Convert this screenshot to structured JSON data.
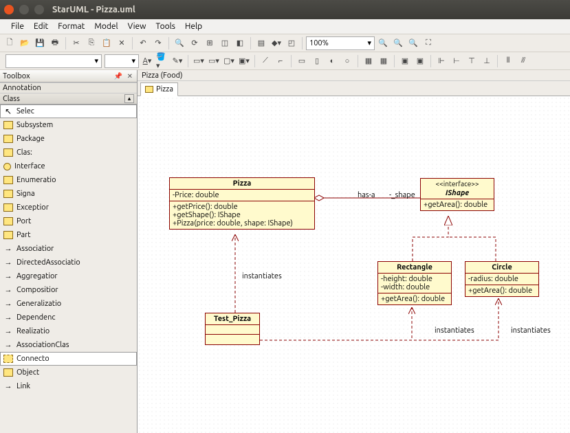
{
  "window": {
    "title": "StarUML - Pizza.uml"
  },
  "menu": [
    "File",
    "Edit",
    "Format",
    "Model",
    "View",
    "Tools",
    "Help"
  ],
  "toolbar": {
    "zoom": "100%"
  },
  "toolbox": {
    "title": "Toolbox",
    "annotation_label": "Annotation",
    "class_label": "Class",
    "items": [
      {
        "label": "Selec",
        "icon": "cursor",
        "sel": true
      },
      {
        "label": "Subsystem",
        "icon": "box"
      },
      {
        "label": "Package",
        "icon": "box"
      },
      {
        "label": "Clas:",
        "icon": "box"
      },
      {
        "label": "Interface",
        "icon": "circle"
      },
      {
        "label": "Enumeratio",
        "icon": "box"
      },
      {
        "label": "Signa",
        "icon": "box"
      },
      {
        "label": "Exceptior",
        "icon": "box"
      },
      {
        "label": "Port",
        "icon": "box"
      },
      {
        "label": "Part",
        "icon": "box"
      },
      {
        "label": "Associatior",
        "icon": "arrow"
      },
      {
        "label": "DirectedAssociatio",
        "icon": "arrow"
      },
      {
        "label": "Aggregatior",
        "icon": "arrow"
      },
      {
        "label": "Compositior",
        "icon": "arrow"
      },
      {
        "label": "Generalizatio",
        "icon": "arrow"
      },
      {
        "label": "Dependenc",
        "icon": "arrow"
      },
      {
        "label": "Realizatio",
        "icon": "arrow"
      },
      {
        "label": "AssociationClas",
        "icon": "arrow"
      },
      {
        "label": "Connecto",
        "icon": "conn",
        "sel": true
      },
      {
        "label": "Object",
        "icon": "box"
      },
      {
        "label": "Link",
        "icon": "arrow"
      }
    ]
  },
  "canvas": {
    "breadcrumb": "Pizza (Food)",
    "tab": "Pizza",
    "classes": {
      "pizza": {
        "name": "Pizza",
        "attrs": "-Price: double",
        "ops": "+getPrice(): double\n+getShape(): IShape\n+Pizza(price: double, shape: IShape)"
      },
      "ishape": {
        "stereo": "<<interface>>",
        "name": "IShape",
        "ops": "+getArea(): double"
      },
      "rectangle": {
        "name": "Rectangle",
        "attrs": "-height: double\n-width: double",
        "ops": "+getArea(): double"
      },
      "circle": {
        "name": "Circle",
        "attrs": "-radius: double",
        "ops": "+getArea(): double"
      },
      "testpizza": {
        "name": "Test_Pizza"
      }
    },
    "labels": {
      "hasa": "has-a",
      "shape": "-_shape",
      "inst1": "instantiates",
      "inst2": "instantiates",
      "inst3": "instantiates"
    }
  }
}
